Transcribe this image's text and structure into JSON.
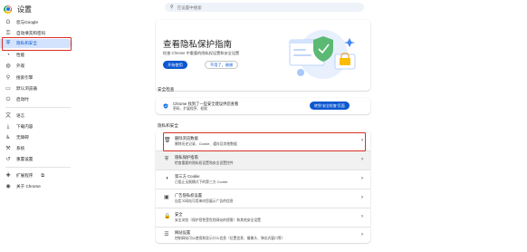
{
  "app": {
    "title": "设置"
  },
  "search": {
    "placeholder": "在设置中搜索"
  },
  "sidebar": {
    "items": [
      {
        "label": "您与Google",
        "icon": "google-g-icon"
      },
      {
        "label": "自动填充和密码",
        "icon": "key-icon"
      },
      {
        "label": "隐私和安全",
        "icon": "shield-icon"
      },
      {
        "label": "性能",
        "icon": "speedometer-icon"
      },
      {
        "label": "外观",
        "icon": "palette-icon"
      },
      {
        "label": "搜索引擎",
        "icon": "search-icon"
      },
      {
        "label": "默认浏览器",
        "icon": "browser-icon"
      },
      {
        "label": "启动时",
        "icon": "power-icon"
      },
      {
        "label": "语言",
        "icon": "translate-icon"
      },
      {
        "label": "下载内容",
        "icon": "download-icon"
      },
      {
        "label": "无障碍",
        "icon": "accessibility-icon"
      },
      {
        "label": "系统",
        "icon": "wrench-icon"
      },
      {
        "label": "重置设置",
        "icon": "reset-icon"
      },
      {
        "label": "扩展程序",
        "icon": "puzzle-icon"
      },
      {
        "label": "关于 Chrome",
        "icon": "chrome-icon"
      }
    ]
  },
  "guide": {
    "title": "查看隐私保护指南",
    "subtitle": "检查 Chrome 中重要的隐私权设置和安全设置",
    "primary_button": "开始使用",
    "secondary_button": "不用了，谢谢"
  },
  "safety": {
    "heading": "安全检查",
    "line1": "Chrome 找到了一些安全建议供您查看",
    "line2": "密码、扩展程序、权限",
    "button": "转到“安全检查”页面"
  },
  "privacy": {
    "heading": "隐私和安全",
    "rows": [
      {
        "title": "删除浏览数据",
        "subtitle": "删除历史记录、Cookie、缓存及其他数据",
        "icon": "trash-icon"
      },
      {
        "title": "隐私保护指南",
        "subtitle": "检查重要的隐私权设置和安全设置控件",
        "icon": "guide-icon"
      },
      {
        "title": "第三方 Cookie",
        "subtitle": "已阻止无痕模式下的第三方 Cookie",
        "icon": "cookie-icon"
      },
      {
        "title": "广告隐私权设置",
        "subtitle": "自定义网站可用来向您展示广告的信息",
        "icon": "ads-icon"
      },
      {
        "title": "安全",
        "subtitle": "安全浏览（保护您免受危险网站的侵害）和其他安全设置",
        "icon": "lock-icon"
      },
      {
        "title": "网站设置",
        "subtitle": "控制网站可以使用和显示什么信息（位置信息、摄像头、弹出式窗口等）",
        "icon": "sliders-icon"
      }
    ]
  },
  "colors": {
    "accent": "#0b57d0",
    "active_bg": "#d3e3fd",
    "highlight": "#d93025"
  }
}
